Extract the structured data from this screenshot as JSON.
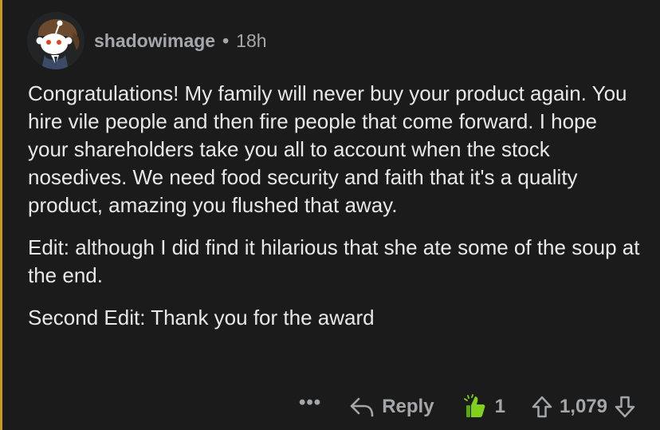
{
  "comment": {
    "username": "shadowimage",
    "separator": "•",
    "time": "18h",
    "paragraphs": [
      "Congratulations! My family will never buy your product again. You hire vile people and then fire people that come forward. I hope your shareholders take you all to account when the stock nosedives. We need food security and faith that it's a quality product, amazing you flushed that away.",
      "Edit: although I did find it hilarious that she ate some of the soup at the end.",
      "Second Edit: Thank you for the award"
    ],
    "actions": {
      "more": "•••",
      "reply": "Reply",
      "award_count": "1",
      "score": "1,079"
    }
  },
  "icons": {
    "avatar": "reddit-snoo-avatar",
    "reply": "reply-arrow-icon",
    "award": "thumbs-up-award-icon",
    "upvote": "upvote-arrow-icon",
    "downvote": "downvote-arrow-icon"
  },
  "colors": {
    "background": "#1b1b1c",
    "thread_line": "#c99a1e",
    "text": "#e8e8e9",
    "muted": "#a4a7aa",
    "award_green": "#7fd11b"
  }
}
